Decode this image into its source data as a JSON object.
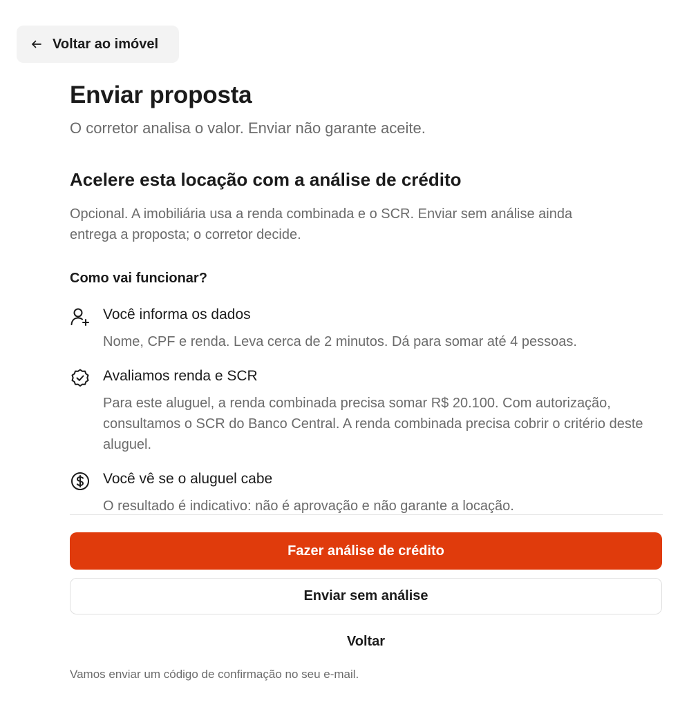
{
  "back": {
    "label": "Voltar ao imóvel",
    "icon": "arrow-left-icon"
  },
  "header": {
    "title": "Enviar proposta",
    "subtitle": "O corretor analisa o valor. Enviar não garante aceite."
  },
  "credit": {
    "title": "Acelere esta locação com a análise de crédito",
    "description": "Opcional. A imobiliária usa a renda combinada e o SCR. Enviar sem análise ainda entrega a proposta; o corretor decide.",
    "how_title": "Como vai funcionar?",
    "steps": [
      {
        "icon": "user-plus-icon",
        "title": "Você informa os dados",
        "description": "Nome, CPF e renda. Leva cerca de 2 minutos. Dá para somar até 4 pessoas."
      },
      {
        "icon": "check-badge-icon",
        "title": "Avaliamos renda e SCR",
        "description": "Para este aluguel, a renda combinada precisa somar R$ 20.100. Com autorização, consultamos o SCR do Banco Central. A renda combinada precisa cobrir o critério deste aluguel."
      },
      {
        "icon": "dollar-circle-icon",
        "title": "Você vê se o aluguel cabe",
        "description": "O resultado é indicativo: não é aprovação e não garante a locação."
      }
    ]
  },
  "actions": {
    "primary_label": "Fazer análise de crédito",
    "secondary_label": "Enviar sem análise",
    "back_label": "Voltar",
    "footnote": "Vamos enviar um código de confirmação no seu e-mail."
  },
  "colors": {
    "accent": "#e03b0c",
    "text": "#1b1b1b",
    "muted": "#6b6b6b"
  }
}
